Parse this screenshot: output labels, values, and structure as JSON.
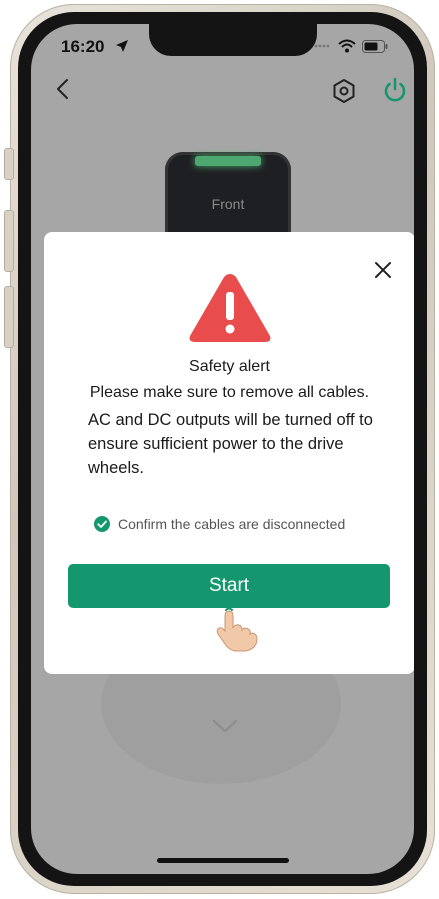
{
  "status_bar": {
    "time": "16:20",
    "icons": [
      "location-arrow-icon",
      "signal-icon",
      "wifi-icon",
      "battery-icon"
    ]
  },
  "nav": {
    "back_icon": "chevron-left-icon",
    "settings_icon": "gear-icon",
    "power_icon": "power-icon"
  },
  "device": {
    "label": "Front"
  },
  "modal": {
    "title": "Safety alert",
    "subtitle": "Please make sure to remove all cables.",
    "body": "AC and DC outputs will be turned off to ensure sufficient power to the drive wheels.",
    "confirm_label": "Confirm the cables are disconnected",
    "confirm_checked": true,
    "start_label": "Start"
  },
  "colors": {
    "accent": "#14976e",
    "warning": "#e84c4c",
    "overlay": "#a6a6a6",
    "power": "#14976e"
  }
}
